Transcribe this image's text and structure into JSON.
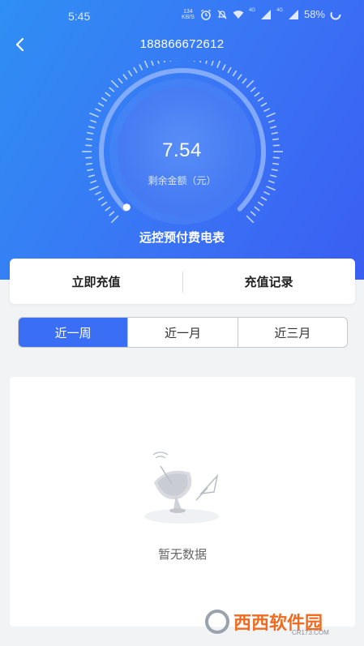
{
  "status_bar": {
    "time": "5:45",
    "speed_value": "134",
    "speed_unit": "KB/S",
    "network_1": "4G",
    "network_2": "4G",
    "battery": "58%"
  },
  "header": {
    "phone_number": "188866672612"
  },
  "meter": {
    "value": "7.54",
    "value_label": "剩余金额（元）",
    "title": "远控预付费电表",
    "fill_fraction": 0.5
  },
  "actions": {
    "recharge": "立即充值",
    "history": "充值记录"
  },
  "range_tabs": [
    {
      "label": "近一周",
      "active": true
    },
    {
      "label": "近一月",
      "active": false
    },
    {
      "label": "近三月",
      "active": false
    }
  ],
  "empty_state": {
    "text": "暂无数据"
  },
  "watermark": {
    "text": "西西软件园",
    "subtext": "CR173.COM"
  },
  "colors": {
    "primary": "#3a6ef4",
    "hero_start": "#2f8ff4",
    "hero_end": "#3a5ef2"
  }
}
